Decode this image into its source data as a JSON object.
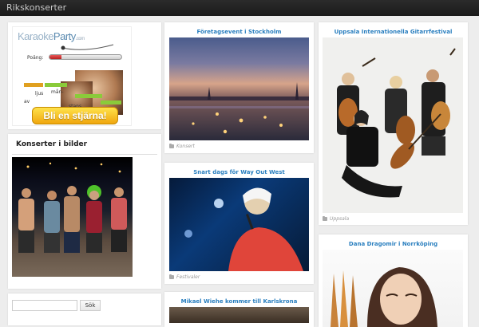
{
  "header": {
    "site_title": "Rikskonserter"
  },
  "ad": {
    "logo_primary": "Karaoke",
    "logo_secondary": "Party",
    "logo_suffix": ".com",
    "score_label": "Poäng:",
    "score_fraction": 0.17,
    "lyric_words": [
      "av",
      "ljus",
      "mån-",
      "stans"
    ],
    "cta_label": "Bli en stjärna!"
  },
  "widgets": {
    "gallery_title": "Konserter i bilder",
    "search_placeholder": "",
    "search_button": "Sök"
  },
  "posts": [
    {
      "title": "Företagsevent i Stockholm",
      "category": "Konsert"
    },
    {
      "title": "Snart dags för Way Out West",
      "category": "Festivaler"
    },
    {
      "title": "Mikael Wiehe kommer till Karlskrona",
      "category": ""
    },
    {
      "title": "Uppsala Internationella Gitarrfestival",
      "category": "Uppsala"
    },
    {
      "title": "Dana Dragomir i Norrköping",
      "category": ""
    }
  ],
  "colors": {
    "accent": "#2a7fbf",
    "topbar": "#222222",
    "background": "#ededed"
  }
}
